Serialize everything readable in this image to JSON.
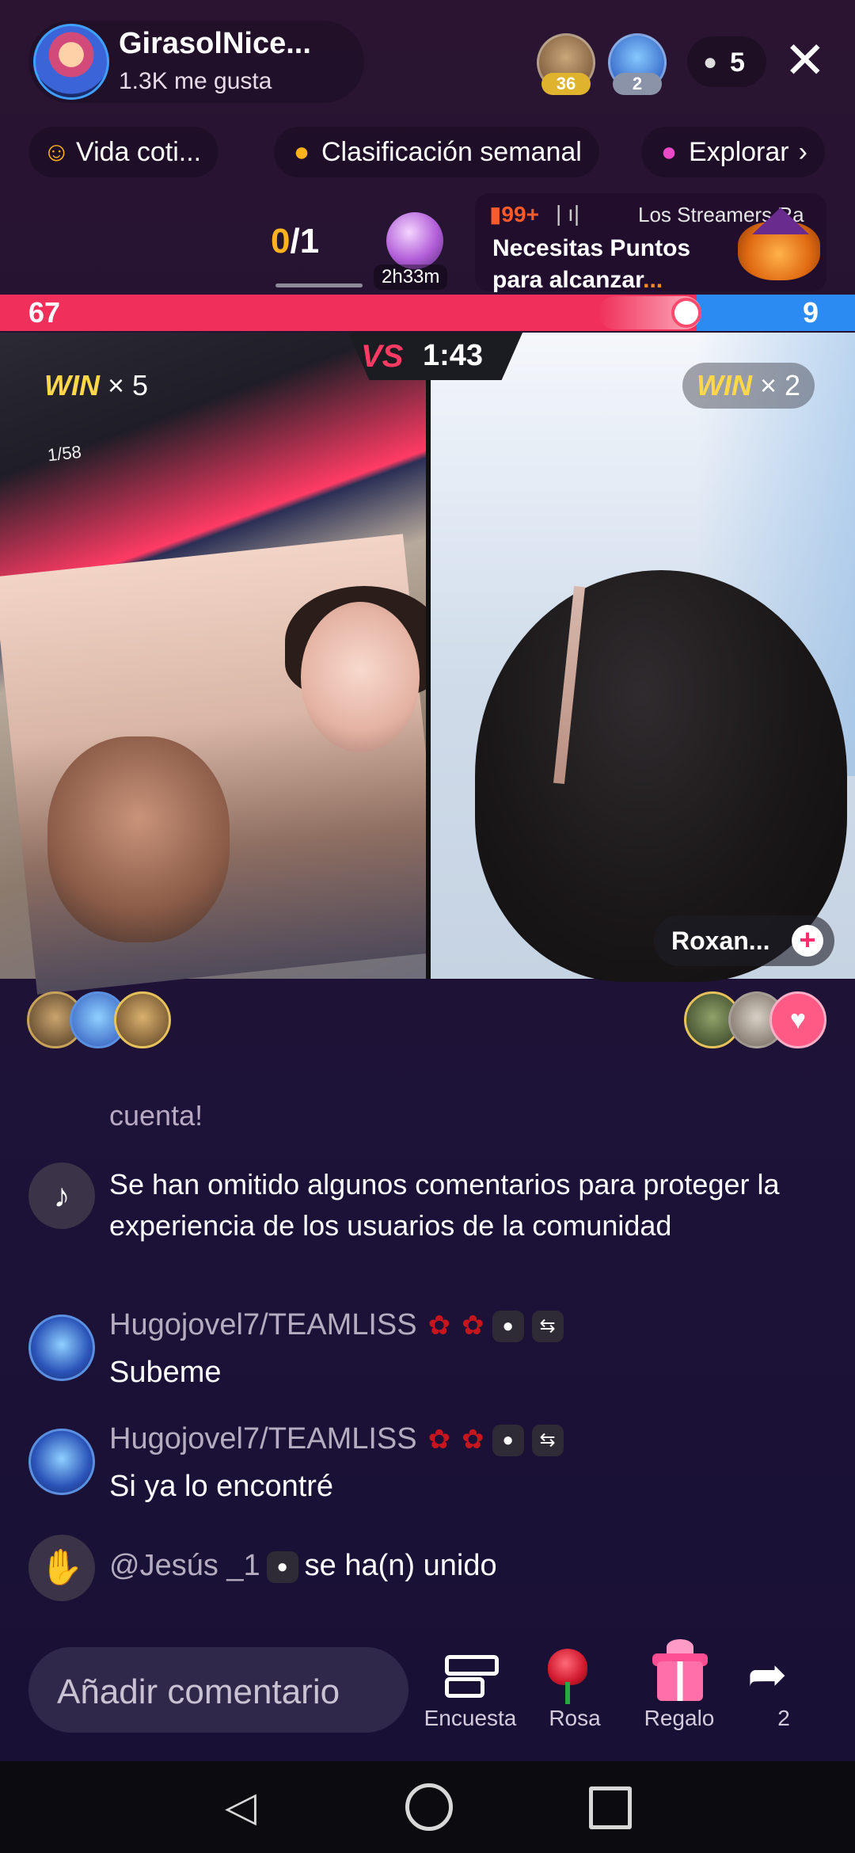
{
  "header": {
    "host_name": "GirasolNice...",
    "host_likes": "1.3K me gusta",
    "top_viewers": [
      {
        "badge": "36"
      },
      {
        "badge": "2"
      }
    ],
    "viewer_count": "5",
    "close_label": "✕"
  },
  "tags": [
    {
      "icon": "emoji-icon",
      "label": "Vida coti..."
    },
    {
      "icon": "flame-icon",
      "label": "Clasificación semanal"
    },
    {
      "icon": "planet-icon",
      "label": "Explorar"
    }
  ],
  "goal": {
    "current": "0",
    "total": "/1",
    "gift_timer": "2h33m"
  },
  "ranking": {
    "badge": "99+",
    "bars": "| ı|",
    "streamers_label": "Los Streamers Ra",
    "message": "Necesitas Puntos para alcanzar",
    "dots": "..."
  },
  "battle": {
    "score_left": "67",
    "score_right": "9",
    "vs_label": "VS",
    "timer": "1:43",
    "win_left": {
      "word": "WIN",
      "mult": "× 5"
    },
    "win_right": {
      "word": "WIN",
      "mult": "× 2"
    },
    "opponent_name": "Roxan...",
    "inner_overlay_text": "1/58"
  },
  "chat": {
    "faded_line": "cuenta!",
    "system_message": "Se han omitido algunos comentarios para proteger la experiencia de los usuarios de la comunidad",
    "messages": [
      {
        "user": "Hugojovel7/TEAMLISS",
        "text": "Subeme"
      },
      {
        "user": "Hugojovel7/TEAMLISS",
        "text": "Si ya lo encontré"
      }
    ],
    "join": {
      "user": "@Jesús _1",
      "text": "se ha(n) unido"
    }
  },
  "bottom_bar": {
    "comment_placeholder": "Añadir comentario",
    "poll_label": "Encuesta",
    "rose_label": "Rosa",
    "gift_label": "Regalo",
    "share_count": "2"
  },
  "colors": {
    "accent_red": "#f0305a",
    "accent_blue": "#2b8bf2",
    "win_gold": "#ffd84a"
  }
}
